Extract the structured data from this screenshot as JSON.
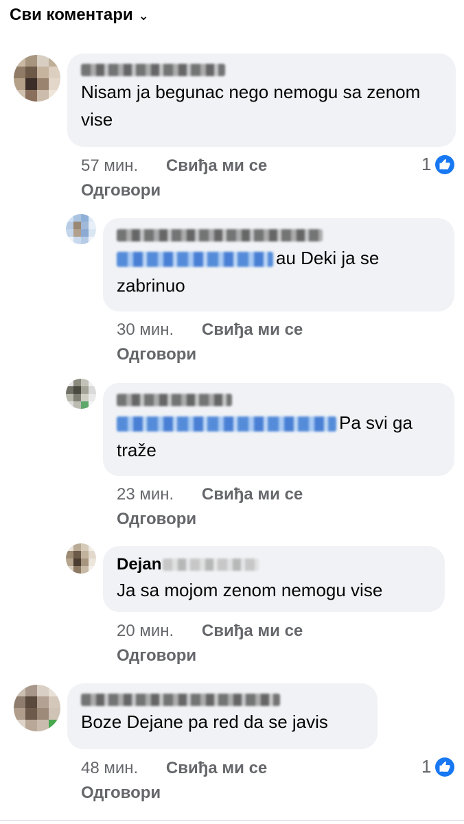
{
  "header": {
    "title": "Сви коментари",
    "chevron": "chevron-down-icon"
  },
  "comments": [
    {
      "text": "Nisam ja begunac nego nemogu sa zenom vise",
      "time": "57 мин.",
      "like_label": "Свиђа ми се",
      "reply_label": "Одговори",
      "reaction_count": "1"
    },
    {
      "text": "au Deki ja se zabrinuo",
      "time": "30 мин.",
      "like_label": "Свиђа ми се",
      "reply_label": "Одговори"
    },
    {
      "text": "Pa svi ga traže",
      "time": "23 мин.",
      "like_label": "Свиђа ми се",
      "reply_label": "Одговори"
    },
    {
      "author": "Dejan",
      "text": "Ja sa mojom zenom nemogu vise",
      "time": "20 мин.",
      "like_label": "Свиђа ми се",
      "reply_label": "Одговори"
    },
    {
      "text": "Boze Dejane pa red da se javis",
      "time": "48 мин.",
      "like_label": "Свиђа ми се",
      "reply_label": "Одговори",
      "reaction_count": "1"
    }
  ],
  "colors": {
    "like_blue": "#1877f2",
    "bubble": "#f0f2f5",
    "meta": "#65676b"
  }
}
